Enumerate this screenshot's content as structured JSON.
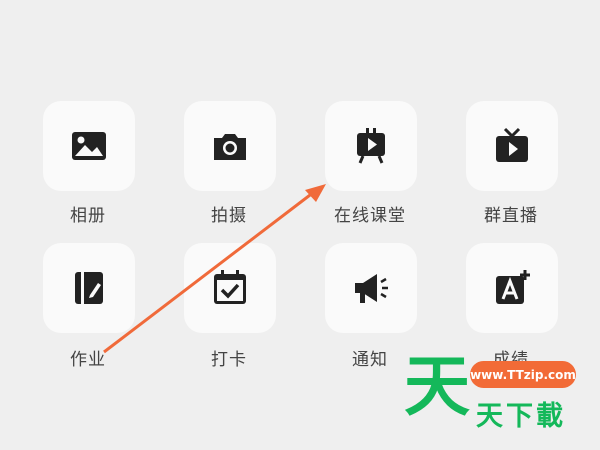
{
  "apps": [
    {
      "label": "相册",
      "icon": "image-icon"
    },
    {
      "label": "拍摄",
      "icon": "camera-icon"
    },
    {
      "label": "在线课堂",
      "icon": "online-class-icon"
    },
    {
      "label": "群直播",
      "icon": "tv-live-icon"
    },
    {
      "label": "作业",
      "icon": "homework-icon"
    },
    {
      "label": "打卡",
      "icon": "calendar-check-icon"
    },
    {
      "label": "通知",
      "icon": "megaphone-icon"
    },
    {
      "label": "成绩",
      "icon": "grade-icon"
    }
  ],
  "colors": {
    "background": "#efefef",
    "tile": "#fafafa",
    "icon": "#222222",
    "label": "#444444",
    "arrow": "#f06a3a",
    "watermark_green": "#14b85a",
    "watermark_badge": "#f26b37"
  },
  "watermark": {
    "badge": "www.TTzip.com",
    "big_char": "天",
    "text": "天下載"
  }
}
